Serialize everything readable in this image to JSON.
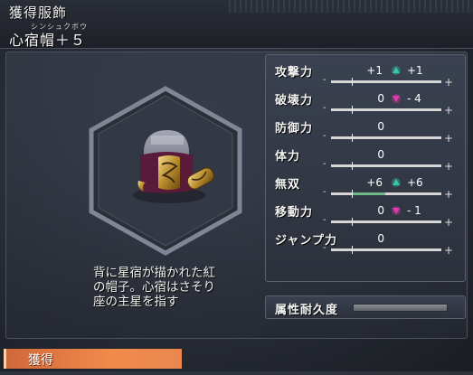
{
  "header": {
    "category": "獲得服飾",
    "reading": "シンシュクボウ",
    "item_name": "心宿帽＋５"
  },
  "item": {
    "icon": "red-helmet-with-gold-ornament-icon",
    "description": [
      "背に星宿が描かれた紅",
      "の帽子。心宿はさそり",
      "座の主星を指す"
    ]
  },
  "stats": [
    {
      "label": "攻撃力",
      "base": "+1",
      "change": "up",
      "new": "+1",
      "fill": 0.0
    },
    {
      "label": "破壊力",
      "base": "0",
      "change": "down",
      "new": "- 4",
      "fill": 0.0
    },
    {
      "label": "防御力",
      "base": "0",
      "change": "",
      "new": "",
      "fill": 0.0
    },
    {
      "label": "体力",
      "base": "0",
      "change": "",
      "new": "",
      "fill": 0.0
    },
    {
      "label": "無双",
      "base": "+6",
      "change": "up",
      "new": "+6",
      "fill": 0.3
    },
    {
      "label": "移動力",
      "base": "0",
      "change": "down",
      "new": "- 1",
      "fill": 0.0
    },
    {
      "label": "ジャンプ力",
      "base": "0",
      "change": "",
      "new": "",
      "fill": 0.0
    }
  ],
  "durability": {
    "label": "属性耐久度",
    "level": 1.0
  },
  "action": {
    "acquire_label": "獲得"
  },
  "colors": {
    "up_arrow": "#35c9a8",
    "down_arrow": "#e23bb0",
    "accent": "#f28a4c"
  }
}
